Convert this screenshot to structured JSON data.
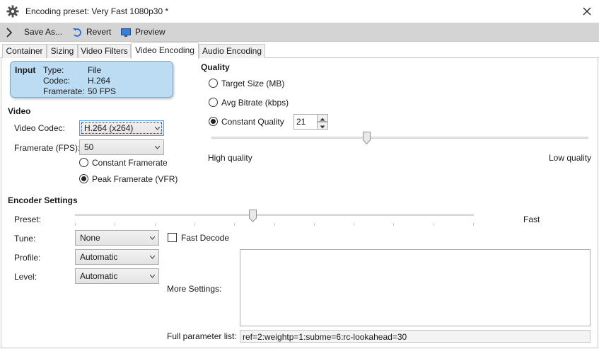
{
  "window": {
    "title": "Encoding preset: Very Fast 1080p30 *"
  },
  "toolbar": {
    "save_as": "Save As...",
    "revert": "Revert",
    "preview": "Preview"
  },
  "tabs": [
    "Container",
    "Sizing",
    "Video Filters",
    "Video Encoding",
    "Audio Encoding"
  ],
  "input": {
    "heading": "Input",
    "type_label": "Type:",
    "type_value": "File",
    "codec_label": "Codec:",
    "codec_value": "H.264",
    "framerate_label": "Framerate:",
    "framerate_value": "50 FPS"
  },
  "video": {
    "heading": "Video",
    "codec_label": "Video Codec:",
    "codec_value": "H.264 (x264)",
    "framerate_label": "Framerate (FPS):",
    "framerate_value": "50",
    "constant_framerate": "Constant Framerate",
    "peak_framerate": "Peak Framerate (VFR)",
    "selected_mode": "peak"
  },
  "quality": {
    "heading": "Quality",
    "target_size": "Target Size (MB)",
    "avg_bitrate": "Avg Bitrate (kbps)",
    "constant_quality": "Constant Quality",
    "selected_mode": "constant",
    "cq_value": "21",
    "slider_fraction": 0.41,
    "high_label": "High quality",
    "low_label": "Low quality"
  },
  "encoder": {
    "heading": "Encoder Settings",
    "preset_label": "Preset:",
    "preset_value_label": "Fast",
    "preset_fraction": 0.445,
    "tune_label": "Tune:",
    "tune_value": "None",
    "fast_decode": "Fast Decode",
    "fast_decode_checked": false,
    "profile_label": "Profile:",
    "profile_value": "Automatic",
    "level_label": "Level:",
    "level_value": "Automatic",
    "more_settings_label": "More Settings:",
    "more_settings_value": "",
    "full_param_label": "Full parameter list:",
    "full_param_value": "ref=2:weightp=1:subme=6:rc-lookahead=30"
  }
}
